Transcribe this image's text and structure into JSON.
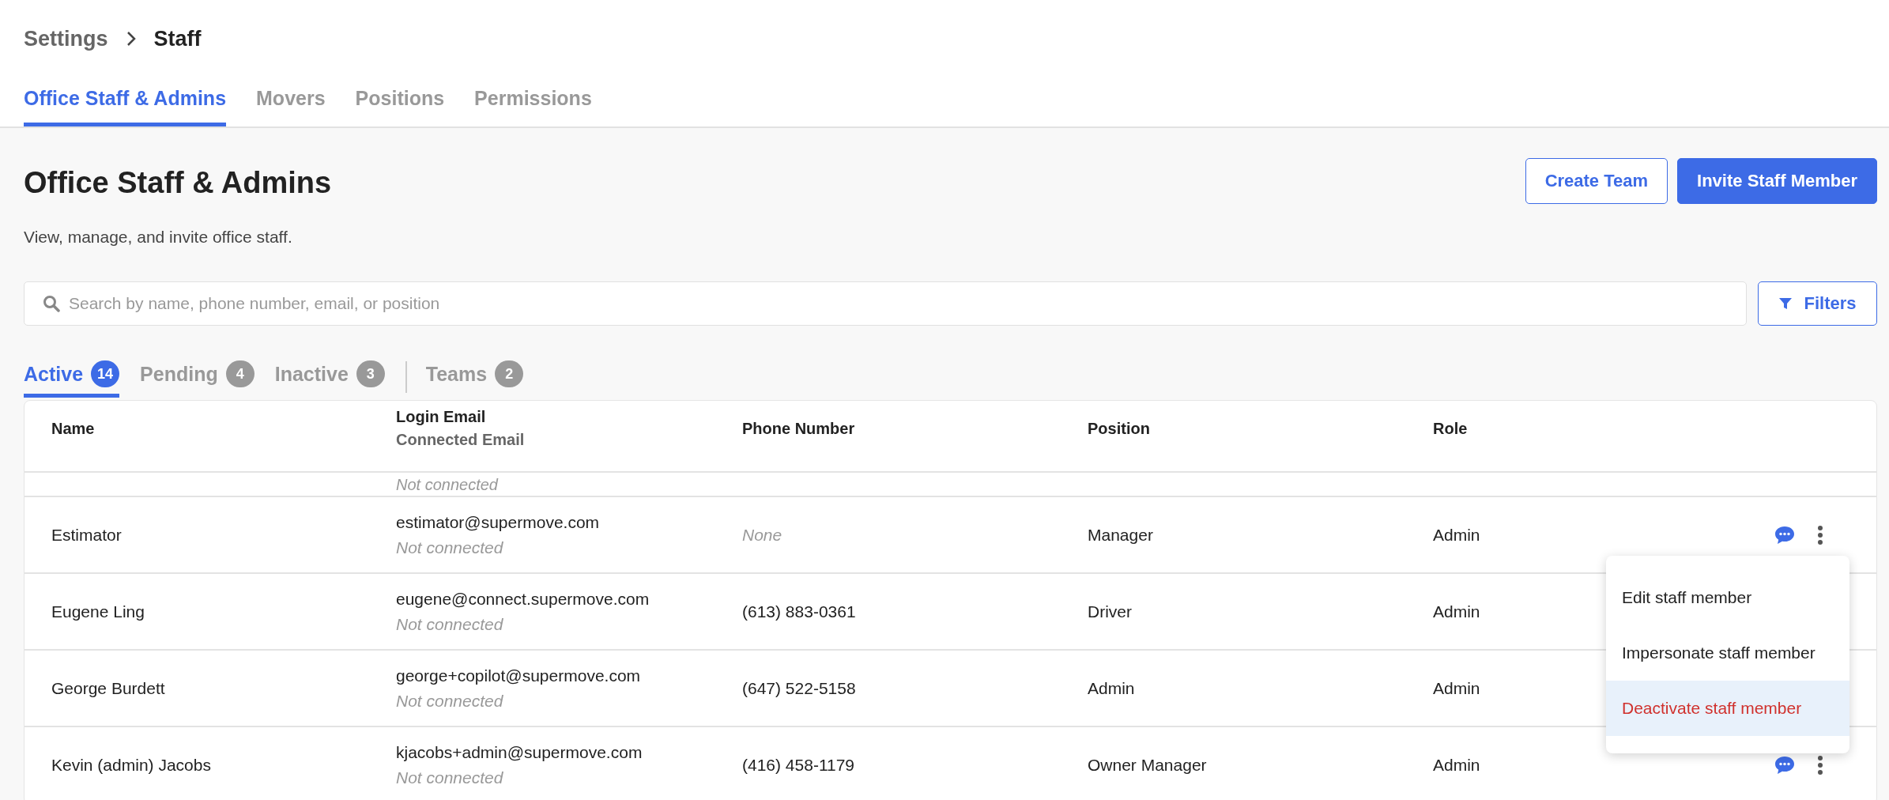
{
  "breadcrumb": [
    {
      "label": "Settings",
      "current": false
    },
    {
      "label": "Staff",
      "current": true
    }
  ],
  "tabs": [
    {
      "label": "Office Staff & Admins",
      "selected": true
    },
    {
      "label": "Movers",
      "selected": false
    },
    {
      "label": "Positions",
      "selected": false
    },
    {
      "label": "Permissions",
      "selected": false
    }
  ],
  "page": {
    "title": "Office Staff & Admins",
    "subtitle": "View, manage, and invite office staff.",
    "buttons": [
      {
        "label": "Create Team",
        "kind": "outline"
      },
      {
        "label": "Invite Staff Member",
        "kind": "primary"
      }
    ]
  },
  "search": {
    "placeholder": "Search by name, phone number, email, or position"
  },
  "filters_button": {
    "label": "Filters"
  },
  "status_tabs": [
    {
      "label": "Active",
      "count": "14",
      "selected": true
    },
    {
      "label": "Pending",
      "count": "4",
      "selected": false
    },
    {
      "label": "Inactive",
      "count": "3",
      "selected": false
    }
  ],
  "team_tabs": [
    {
      "label": "Teams",
      "count": "2",
      "selected": false
    }
  ],
  "table": {
    "columns": [
      {
        "label": "Name"
      },
      {
        "label": "Login Email",
        "sublabel": "Connected Email"
      },
      {
        "label": "Phone Number"
      },
      {
        "label": "Position"
      },
      {
        "label": "Role"
      }
    ],
    "partial_row": {
      "connected_email": "Not connected"
    },
    "rows": [
      {
        "name": "Estimator",
        "login_email": "estimator@supermove.com",
        "connected_email": "Not connected",
        "phone": "None",
        "phone_missing": true,
        "position": "Manager",
        "role": "Admin"
      },
      {
        "name": "Eugene Ling",
        "login_email": "eugene@connect.supermove.com",
        "connected_email": "Not connected",
        "phone": "(613) 883-0361",
        "phone_missing": false,
        "position": "Driver",
        "role": "Admin"
      },
      {
        "name": "George Burdett",
        "login_email": "george+copilot@supermove.com",
        "connected_email": "Not connected",
        "phone": "(647) 522-5158",
        "phone_missing": false,
        "position": "Admin",
        "role": "Admin"
      },
      {
        "name": "Kevin (admin) Jacobs",
        "login_email": "kjacobs+admin@supermove.com",
        "connected_email": "Not connected",
        "phone": "(416) 458-1179",
        "phone_missing": false,
        "position": "Owner Manager",
        "role": "Admin"
      }
    ]
  },
  "row_menu": {
    "items": [
      {
        "label": "Edit staff member",
        "kind": "default",
        "highlighted": false
      },
      {
        "label": "Impersonate staff member",
        "kind": "default",
        "highlighted": false
      },
      {
        "label": "Deactivate staff member",
        "kind": "danger",
        "highlighted": true
      }
    ]
  }
}
